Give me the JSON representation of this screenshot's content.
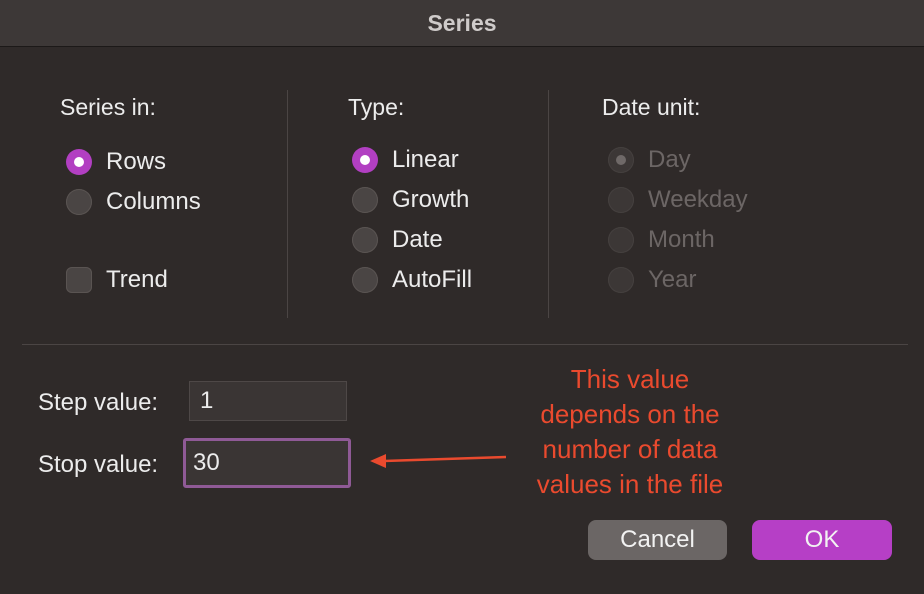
{
  "dialog": {
    "title": "Series"
  },
  "series_in": {
    "title": "Series in:",
    "options": [
      {
        "label": "Rows",
        "selected": true
      },
      {
        "label": "Columns",
        "selected": false
      }
    ],
    "trend": {
      "label": "Trend",
      "checked": false
    }
  },
  "type": {
    "title": "Type:",
    "options": [
      {
        "label": "Linear",
        "selected": true
      },
      {
        "label": "Growth",
        "selected": false
      },
      {
        "label": "Date",
        "selected": false
      },
      {
        "label": "AutoFill",
        "selected": false
      }
    ]
  },
  "date_unit": {
    "title": "Date unit:",
    "disabled": true,
    "options": [
      {
        "label": "Day",
        "selected": true
      },
      {
        "label": "Weekday",
        "selected": false
      },
      {
        "label": "Month",
        "selected": false
      },
      {
        "label": "Year",
        "selected": false
      }
    ]
  },
  "step": {
    "label": "Step value:",
    "value": "1"
  },
  "stop": {
    "label": "Stop value:",
    "value": "30"
  },
  "annotation": {
    "lines": [
      "This value",
      "depends on the",
      "number of data",
      "values in the file"
    ],
    "color": "#ea4a2e"
  },
  "buttons": {
    "cancel": "Cancel",
    "ok": "OK"
  },
  "colors": {
    "accent": "#b63fc6",
    "background": "#2f2a29"
  }
}
